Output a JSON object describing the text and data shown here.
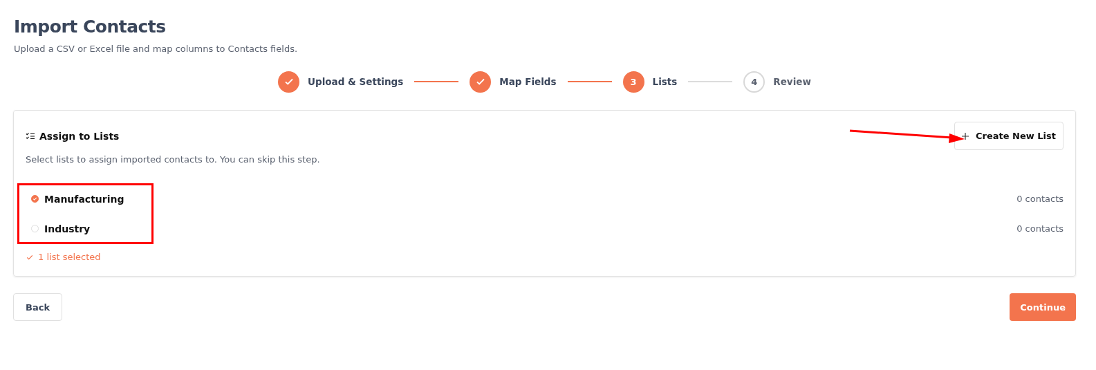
{
  "page": {
    "title": "Import Contacts",
    "subtitle": "Upload a CSV or Excel file and map columns to Contacts fields."
  },
  "steps": [
    {
      "label": "Upload & Settings",
      "done": true,
      "current": false
    },
    {
      "label": "Map Fields",
      "done": true,
      "current": false
    },
    {
      "number": "3",
      "label": "Lists",
      "done": false,
      "current": true
    },
    {
      "number": "4",
      "label": "Review",
      "done": false,
      "current": false
    }
  ],
  "card": {
    "title": "Assign to Lists",
    "description": "Select lists to assign imported contacts to. You can skip this step.",
    "create_button": "Create New List",
    "lists": [
      {
        "name": "Manufacturing",
        "count": "0 contacts",
        "checked": true
      },
      {
        "name": "Industry",
        "count": "0 contacts",
        "checked": false
      }
    ],
    "selection_summary": "1 list selected"
  },
  "footer": {
    "back": "Back",
    "continue": "Continue"
  }
}
